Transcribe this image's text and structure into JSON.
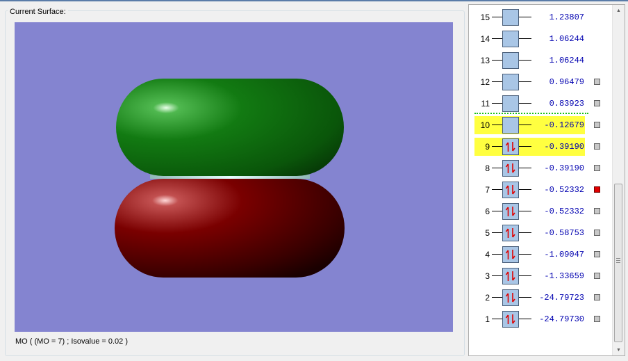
{
  "group_title": "Current Surface:",
  "status_text": "MO ( (MO = 7) ; Isovalue = 0.02 )",
  "colors": {
    "viewport_bg": "#8484d0",
    "positive_lobe": "#0e6e0e",
    "negative_lobe": "#7a0000",
    "highlight": "#ffff40",
    "energy_text": "#0000b0",
    "homo_lumo_divider": "#18c018",
    "selected_marker": "#e00000"
  },
  "icons": {
    "occupied": "paired-electrons-icon",
    "scroll_up": "arrow-up-icon",
    "scroll_down": "arrow-down-icon"
  },
  "orbitals": [
    {
      "num": "15",
      "energy": "1.23807",
      "occupied": false,
      "highlighted": false,
      "marker": "none"
    },
    {
      "num": "14",
      "energy": "1.06244",
      "occupied": false,
      "highlighted": false,
      "marker": "none"
    },
    {
      "num": "13",
      "energy": "1.06244",
      "occupied": false,
      "highlighted": false,
      "marker": "none"
    },
    {
      "num": "12",
      "energy": "0.96479",
      "occupied": false,
      "highlighted": false,
      "marker": "gray"
    },
    {
      "num": "11",
      "energy": "0.83923",
      "occupied": false,
      "highlighted": false,
      "marker": "gray"
    },
    {
      "num": "10",
      "energy": "-0.12679",
      "occupied": false,
      "highlighted": true,
      "marker": "gray"
    },
    {
      "num": "9",
      "energy": "-0.39190",
      "occupied": true,
      "highlighted": true,
      "marker": "gray"
    },
    {
      "num": "8",
      "energy": "-0.39190",
      "occupied": true,
      "highlighted": false,
      "marker": "gray"
    },
    {
      "num": "7",
      "energy": "-0.52332",
      "occupied": true,
      "highlighted": false,
      "marker": "red"
    },
    {
      "num": "6",
      "energy": "-0.52332",
      "occupied": true,
      "highlighted": false,
      "marker": "gray"
    },
    {
      "num": "5",
      "energy": "-0.58753",
      "occupied": true,
      "highlighted": false,
      "marker": "gray"
    },
    {
      "num": "4",
      "energy": "-1.09047",
      "occupied": true,
      "highlighted": false,
      "marker": "gray"
    },
    {
      "num": "3",
      "energy": "-1.33659",
      "occupied": true,
      "highlighted": false,
      "marker": "gray"
    },
    {
      "num": "2",
      "energy": "-24.79723",
      "occupied": true,
      "highlighted": false,
      "marker": "gray"
    },
    {
      "num": "1",
      "energy": "-24.79730",
      "occupied": true,
      "highlighted": false,
      "marker": "gray"
    }
  ]
}
